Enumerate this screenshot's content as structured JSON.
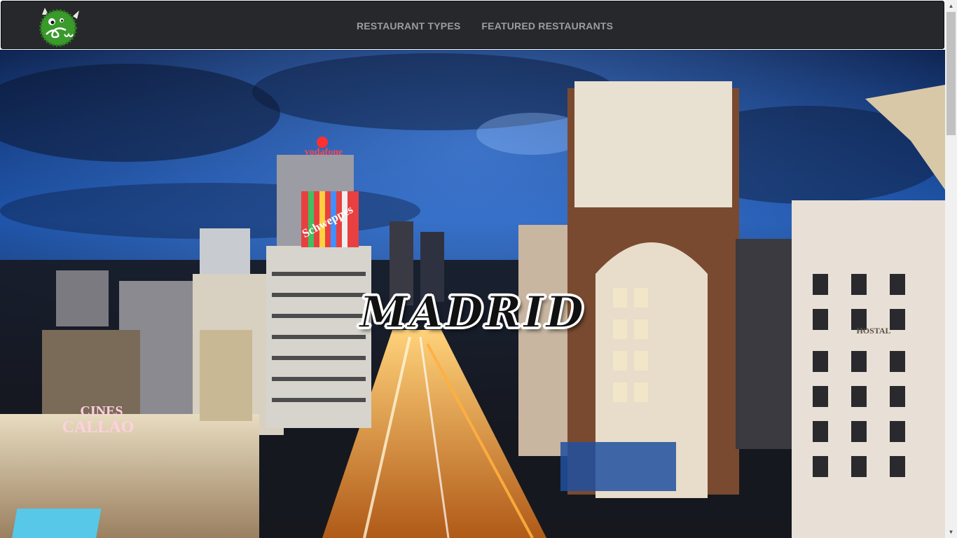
{
  "navbar": {
    "logo_alt": "logo",
    "links": [
      {
        "label": "RESTAURANT TYPES"
      },
      {
        "label": "FEATURED RESTAURANTS"
      }
    ]
  },
  "hero": {
    "title": "MADRID",
    "signs": {
      "cinema_line1": "CINES",
      "cinema_line2": "CALLAO",
      "billboard": "Schweppes",
      "rooftop": "vodafone",
      "hotel": "HOSTAL"
    }
  },
  "colors": {
    "navbar_bg": "#27282c",
    "nav_text": "#9d9d9d",
    "logo_green": "#3a9a2c"
  }
}
